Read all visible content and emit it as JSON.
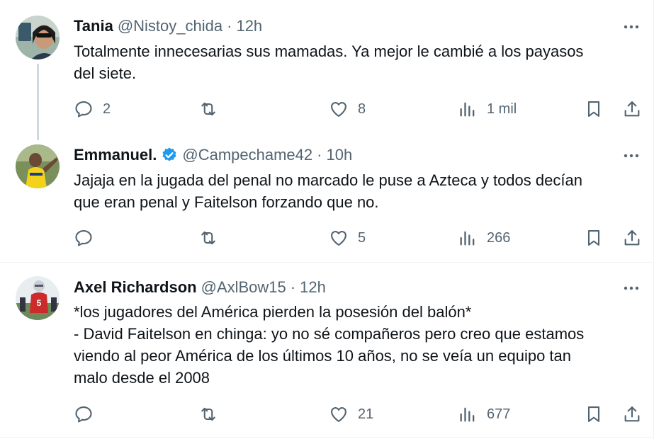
{
  "tweets": [
    {
      "name": "Tania",
      "verified": false,
      "handle": "@Nistoy_chida",
      "sep": "·",
      "time": "12h",
      "lines": [
        "Totalmente innecesarias sus mamadas. Ya mejor le cambié a los payasos",
        "del siete."
      ],
      "replies": "2",
      "retweets": "",
      "likes": "8",
      "views": "1 mil"
    },
    {
      "name": "Emmanuel.",
      "verified": true,
      "handle": "@Campechame42",
      "sep": "·",
      "time": "10h",
      "lines": [
        "Jajaja en la jugada del penal no marcado le puse a Azteca y todos decían",
        "que eran penal y Faitelson forzando que no."
      ],
      "replies": "",
      "retweets": "",
      "likes": "5",
      "views": "266"
    },
    {
      "name": "Axel Richardson",
      "verified": false,
      "handle": "@AxlBow15",
      "sep": "·",
      "time": "12h",
      "lines": [
        "*los jugadores del América pierden la posesión del balón*",
        "- David Faitelson en chinga: yo no sé compañeros pero creo que estamos",
        "viendo al peor América de los últimos 10 años, no se veía un equipo tan",
        "malo desde el 2008"
      ],
      "replies": "",
      "retweets": "",
      "likes": "21",
      "views": "677"
    }
  ],
  "colors": {
    "muted": "#536471",
    "text": "#0f1419",
    "verified": "#1d9bf0",
    "thread": "#cfd9de"
  },
  "icons": [
    "reply-icon",
    "retweet-icon",
    "like-icon",
    "views-icon",
    "bookmark-icon",
    "share-icon",
    "more-icon",
    "verified-badge-icon"
  ]
}
